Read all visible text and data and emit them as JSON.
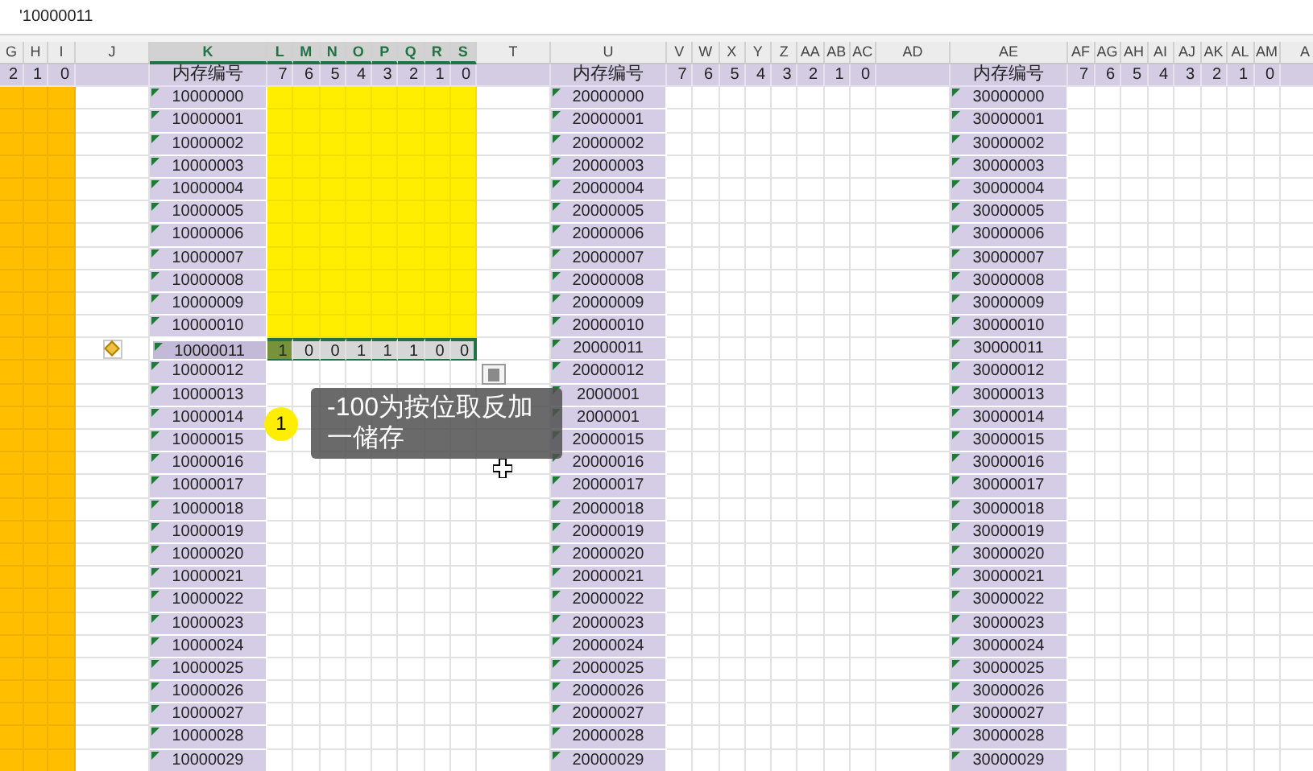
{
  "formula_bar": {
    "value": "'10000011"
  },
  "columns": [
    {
      "label": "G",
      "kind": "flag",
      "selected": false,
      "header": "2"
    },
    {
      "label": "H",
      "kind": "flag",
      "selected": false,
      "header": "1"
    },
    {
      "label": "I",
      "kind": "flag",
      "selected": false,
      "header": "0"
    },
    {
      "label": "J",
      "kind": "gap",
      "selected": false
    },
    {
      "label": "K",
      "kind": "id",
      "selected": true,
      "header": "内存编号"
    },
    {
      "label": "L",
      "kind": "bit",
      "selected": true,
      "header": "7"
    },
    {
      "label": "M",
      "kind": "bit",
      "selected": true,
      "header": "6"
    },
    {
      "label": "N",
      "kind": "bit",
      "selected": true,
      "header": "5"
    },
    {
      "label": "O",
      "kind": "bit",
      "selected": true,
      "header": "4"
    },
    {
      "label": "P",
      "kind": "bit",
      "selected": true,
      "header": "3"
    },
    {
      "label": "Q",
      "kind": "bit",
      "selected": true,
      "header": "2"
    },
    {
      "label": "R",
      "kind": "bit",
      "selected": true,
      "header": "1"
    },
    {
      "label": "S",
      "kind": "bit",
      "selected": true,
      "header": "0"
    },
    {
      "label": "T",
      "kind": "gap",
      "selected": false
    },
    {
      "label": "U",
      "kind": "id",
      "selected": false,
      "header": "内存编号"
    },
    {
      "label": "V",
      "kind": "bit",
      "selected": false,
      "header": "7"
    },
    {
      "label": "W",
      "kind": "bit",
      "selected": false,
      "header": "6"
    },
    {
      "label": "X",
      "kind": "bit",
      "selected": false,
      "header": "5"
    },
    {
      "label": "Y",
      "kind": "bit",
      "selected": false,
      "header": "4"
    },
    {
      "label": "Z",
      "kind": "bit",
      "selected": false,
      "header": "3"
    },
    {
      "label": "AA",
      "kind": "bit",
      "selected": false,
      "header": "2"
    },
    {
      "label": "AB",
      "kind": "bit",
      "selected": false,
      "header": "1"
    },
    {
      "label": "AC",
      "kind": "bit",
      "selected": false,
      "header": "0"
    },
    {
      "label": "AD",
      "kind": "gap",
      "selected": false
    },
    {
      "label": "AE",
      "kind": "id",
      "selected": false,
      "header": "内存编号"
    },
    {
      "label": "AF",
      "kind": "bit",
      "selected": false,
      "header": "7"
    },
    {
      "label": "AG",
      "kind": "bit",
      "selected": false,
      "header": "6"
    },
    {
      "label": "AH",
      "kind": "bit",
      "selected": false,
      "header": "5"
    },
    {
      "label": "AI",
      "kind": "bit",
      "selected": false,
      "header": "4"
    },
    {
      "label": "AJ",
      "kind": "bit",
      "selected": false,
      "header": "3"
    },
    {
      "label": "AK",
      "kind": "bit",
      "selected": false,
      "header": "2"
    },
    {
      "label": "AL",
      "kind": "bit",
      "selected": false,
      "header": "1"
    },
    {
      "label": "AM",
      "kind": "bit",
      "selected": false,
      "header": "0"
    },
    {
      "label": "A",
      "kind": "gap",
      "selected": false
    }
  ],
  "rows": [
    {
      "ids": [
        "10000000",
        "20000000",
        "30000000"
      ],
      "yellow": true,
      "selected": false
    },
    {
      "ids": [
        "10000001",
        "20000001",
        "30000001"
      ],
      "yellow": true,
      "selected": false
    },
    {
      "ids": [
        "10000002",
        "20000002",
        "30000002"
      ],
      "yellow": true,
      "selected": false
    },
    {
      "ids": [
        "10000003",
        "20000003",
        "30000003"
      ],
      "yellow": true,
      "selected": false
    },
    {
      "ids": [
        "10000004",
        "20000004",
        "30000004"
      ],
      "yellow": true,
      "selected": false
    },
    {
      "ids": [
        "10000005",
        "20000005",
        "30000005"
      ],
      "yellow": true,
      "selected": false
    },
    {
      "ids": [
        "10000006",
        "20000006",
        "30000006"
      ],
      "yellow": true,
      "selected": false
    },
    {
      "ids": [
        "10000007",
        "20000007",
        "30000007"
      ],
      "yellow": true,
      "selected": false
    },
    {
      "ids": [
        "10000008",
        "20000008",
        "30000008"
      ],
      "yellow": true,
      "selected": false
    },
    {
      "ids": [
        "10000009",
        "20000009",
        "30000009"
      ],
      "yellow": true,
      "selected": false
    },
    {
      "ids": [
        "10000010",
        "20000010",
        "30000010"
      ],
      "yellow": true,
      "selected": false
    },
    {
      "ids": [
        "10000011",
        "20000011",
        "30000011"
      ],
      "yellow": false,
      "selected": true,
      "warning": true,
      "bits": [
        {
          "value": "1",
          "active": true
        },
        {
          "value": "0",
          "active": false
        },
        {
          "value": "0",
          "active": false
        },
        {
          "value": "1",
          "active": false
        },
        {
          "value": "1",
          "active": false
        },
        {
          "value": "1",
          "active": false
        },
        {
          "value": "0",
          "active": false
        },
        {
          "value": "0",
          "active": false
        }
      ]
    },
    {
      "ids": [
        "10000012",
        "20000012",
        "30000012"
      ],
      "yellow": false,
      "selected": false
    },
    {
      "ids": [
        "10000013",
        "2000001",
        "30000013"
      ],
      "yellow": false,
      "selected": false
    },
    {
      "ids": [
        "10000014",
        "2000001",
        "30000014"
      ],
      "yellow": false,
      "selected": false
    },
    {
      "ids": [
        "10000015",
        "20000015",
        "30000015"
      ],
      "yellow": false,
      "selected": false
    },
    {
      "ids": [
        "10000016",
        "20000016",
        "30000016"
      ],
      "yellow": false,
      "selected": false
    },
    {
      "ids": [
        "10000017",
        "20000017",
        "30000017"
      ],
      "yellow": false,
      "selected": false
    },
    {
      "ids": [
        "10000018",
        "20000018",
        "30000018"
      ],
      "yellow": false,
      "selected": false
    },
    {
      "ids": [
        "10000019",
        "20000019",
        "30000019"
      ],
      "yellow": false,
      "selected": false
    },
    {
      "ids": [
        "10000020",
        "20000020",
        "30000020"
      ],
      "yellow": false,
      "selected": false
    },
    {
      "ids": [
        "10000021",
        "20000021",
        "30000021"
      ],
      "yellow": false,
      "selected": false
    },
    {
      "ids": [
        "10000022",
        "20000022",
        "30000022"
      ],
      "yellow": false,
      "selected": false
    },
    {
      "ids": [
        "10000023",
        "20000023",
        "30000023"
      ],
      "yellow": false,
      "selected": false
    },
    {
      "ids": [
        "10000024",
        "20000024",
        "30000024"
      ],
      "yellow": false,
      "selected": false
    },
    {
      "ids": [
        "10000025",
        "20000025",
        "30000025"
      ],
      "yellow": false,
      "selected": false
    },
    {
      "ids": [
        "10000026",
        "20000026",
        "30000026"
      ],
      "yellow": false,
      "selected": false
    },
    {
      "ids": [
        "10000027",
        "20000027",
        "30000027"
      ],
      "yellow": false,
      "selected": false
    },
    {
      "ids": [
        "10000028",
        "20000028",
        "30000028"
      ],
      "yellow": false,
      "selected": false
    },
    {
      "ids": [
        "10000029",
        "20000029",
        "30000029"
      ],
      "yellow": false,
      "selected": false
    }
  ],
  "callout": {
    "number": "1",
    "text": "-100为按位取反加一储存"
  }
}
